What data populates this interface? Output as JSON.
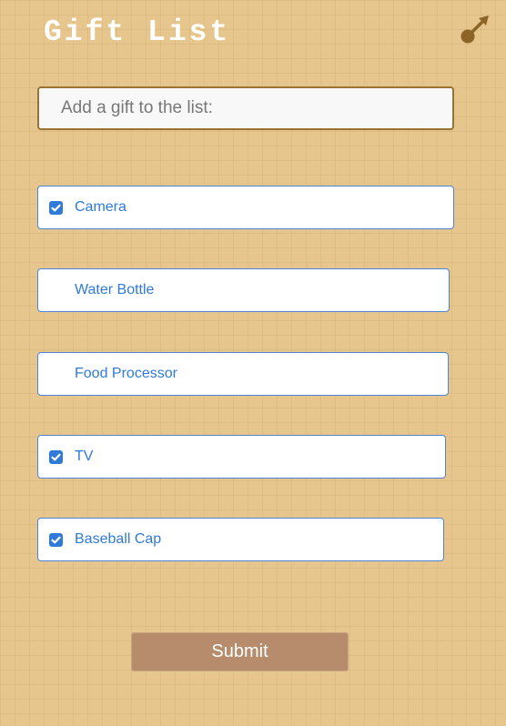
{
  "header": {
    "title": "Gift List",
    "corner_icon": "pin-arrow-icon"
  },
  "add_gift": {
    "placeholder": "Add a gift to the list:",
    "value": ""
  },
  "gifts": [
    {
      "label": "Camera",
      "checked": true
    },
    {
      "label": "Water Bottle",
      "checked": false
    },
    {
      "label": "Food Processor",
      "checked": false
    },
    {
      "label": "TV",
      "checked": true
    },
    {
      "label": "Baseball Cap",
      "checked": true
    }
  ],
  "submit": {
    "label": "Submit"
  },
  "colors": {
    "background": "#e6c68d",
    "accent_blue": "#2f7ad8",
    "submit_bg": "#b68c6c",
    "input_border": "#9a7332",
    "icon": "#8c6428"
  }
}
